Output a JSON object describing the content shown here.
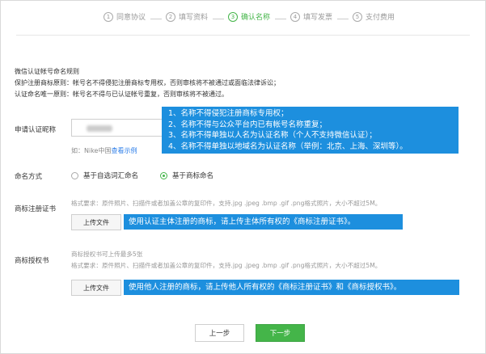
{
  "steps": [
    {
      "num": "1",
      "label": "同意协议",
      "active": false
    },
    {
      "num": "2",
      "label": "填写资料",
      "active": false
    },
    {
      "num": "3",
      "label": "确认名称",
      "active": true
    },
    {
      "num": "4",
      "label": "填写发票",
      "active": false
    },
    {
      "num": "5",
      "label": "支付费用",
      "active": false
    }
  ],
  "rules": {
    "title": "微信认证帐号命名规则",
    "line1": "保护注册商标原则：帐号名不得侵犯注册商标专用权，否则审核将不被通过或面临法律诉讼；",
    "line2": "认证命名唯一原则：帐号名不得与已认证帐号重复，否则审核将不被通过。"
  },
  "nickname": {
    "label": "申请认证昵称",
    "hint_prefix": "如：Nike中国",
    "hint_link": "查看示例"
  },
  "callout_main": [
    "1、名称不得侵犯注册商标专用权；",
    "2、名称不得与公众平台内已有帐号名称重复；",
    "3、名称不得单独以人名为认证名称（个人不支持微信认证）；",
    "4、名称不得单独以地域名为认证名称（举例：北京、上海、深圳等）。"
  ],
  "naming": {
    "label": "命名方式",
    "option1": "基于自选词汇命名",
    "option2": "基于商标命名",
    "selected": "基于商标命名"
  },
  "trademark_cert": {
    "label": "商标注册证书",
    "format": "格式要求：原件照片、扫描件或者加盖公章的复印件，支持.jpg .jpeg .bmp .gif .png格式照片，大小不超过5M。",
    "upload": "上传文件",
    "tip": "使用认证主体注册的商标，请上传主体所有权的《商标注册证书》。"
  },
  "trademark_auth": {
    "label": "商标授权书",
    "limit": "商标授权书可上传最多5张",
    "format": "格式要求：原件照片、扫描件或者加盖公章的复印件，支持.jpg .jpeg .bmp .gif .png格式照片，大小不超过5M。",
    "upload": "上传文件",
    "tip": "使用他人注册的商标，请上传他人所有权的《商标注册证书》和《商标授权书》。"
  },
  "buttons": {
    "prev": "上一步",
    "next": "下一步"
  },
  "colors": {
    "accent": "#44b549",
    "callout": "#1d8fde",
    "link": "#2b7de9"
  }
}
